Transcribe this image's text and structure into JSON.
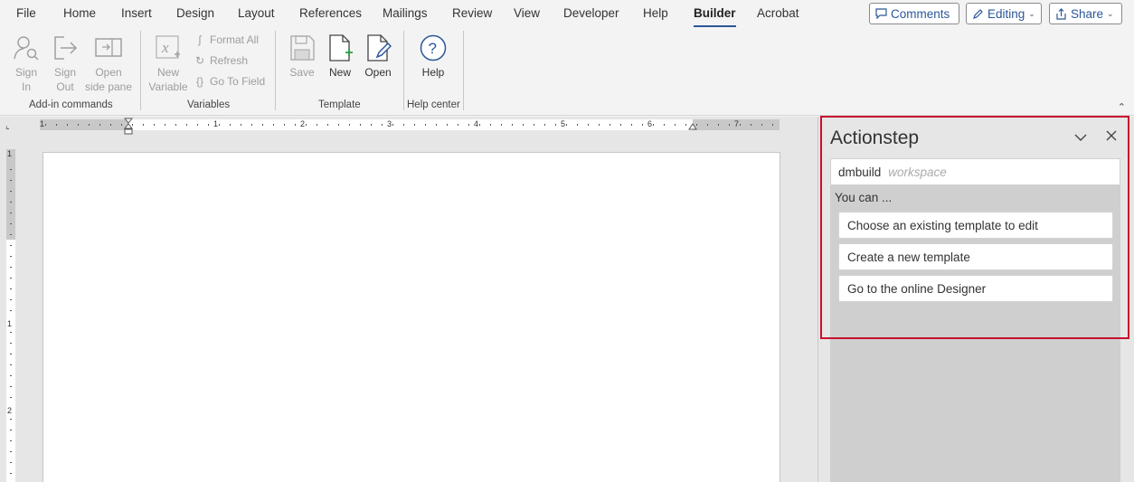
{
  "tabs": [
    "File",
    "Home",
    "Insert",
    "Design",
    "Layout",
    "References",
    "Mailings",
    "Review",
    "View",
    "Developer",
    "Help",
    "Builder",
    "Acrobat"
  ],
  "active_tab": "Builder",
  "top_buttons": {
    "comments": "Comments",
    "editing": "Editing",
    "share": "Share"
  },
  "ribbon": {
    "addin": {
      "sign_in": [
        "Sign",
        "In"
      ],
      "sign_out": [
        "Sign",
        "Out"
      ],
      "open_side_pane": [
        "Open",
        "side pane"
      ],
      "group_label": "Add-in commands"
    },
    "variables": {
      "new_variable": [
        "New",
        "Variable"
      ],
      "format_all": "Format All",
      "refresh": "Refresh",
      "go_to_field": "Go To Field",
      "group_label": "Variables"
    },
    "template": {
      "save": "Save",
      "new": "New",
      "open": "Open",
      "group_label": "Template"
    },
    "help": {
      "help": "Help",
      "group_label": "Help center"
    }
  },
  "ruler": {
    "h_numbers": [
      "1",
      "1",
      "2",
      "3",
      "4",
      "5",
      "6",
      "7"
    ],
    "v_numbers": [
      "1",
      "1",
      "2"
    ]
  },
  "pane": {
    "title": "Actionstep",
    "workspace_name": "dmbuild",
    "workspace_label": "workspace",
    "you_can": "You can ...",
    "options": [
      "Choose an existing template to edit",
      "Create a new template",
      "Go to the online Designer"
    ]
  },
  "colors": {
    "accent": "#2b579a",
    "highlight": "#c8102e",
    "pane_bg": "#cfcfcf"
  }
}
